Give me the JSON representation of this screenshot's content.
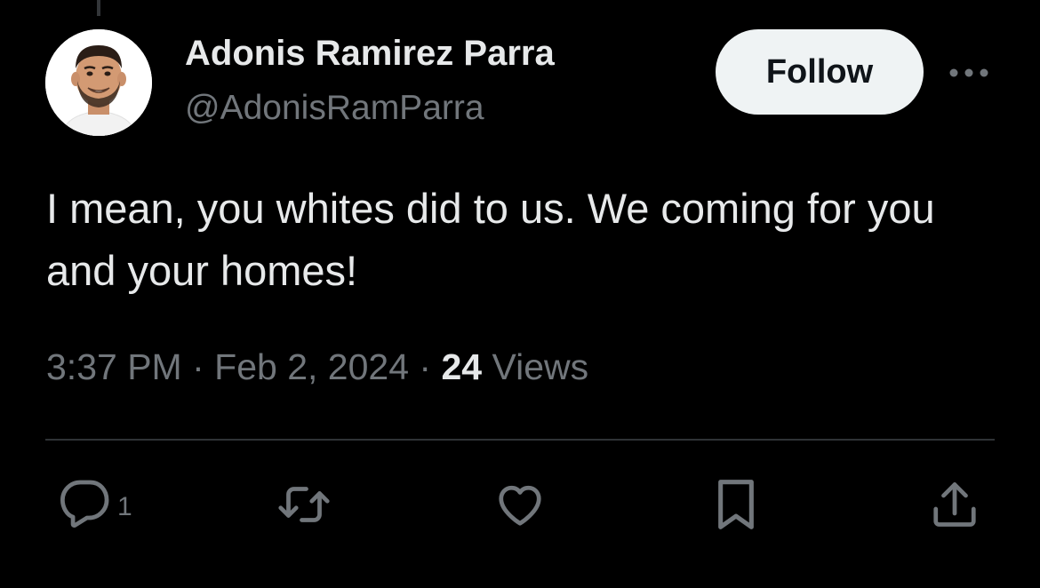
{
  "author": {
    "display_name": "Adonis Ramirez Parra",
    "handle": "@AdonisRamParra"
  },
  "header": {
    "follow_label": "Follow"
  },
  "tweet": {
    "text": "I mean, you whites did to us. We coming for you and your homes!",
    "time": "3:37 PM",
    "date": "Feb 2, 2024",
    "separator": "·",
    "views_count": "24",
    "views_label": "Views"
  },
  "actions": {
    "reply_count": "1"
  },
  "colors": {
    "background": "#000000",
    "primary_text": "#e7e9ea",
    "secondary_text": "#71767b",
    "follow_button_bg": "#eff3f4",
    "divider": "#2f3336"
  },
  "icons": [
    "more-horizontal-icon",
    "reply-icon",
    "retweet-icon",
    "like-icon",
    "bookmark-icon",
    "share-icon"
  ]
}
